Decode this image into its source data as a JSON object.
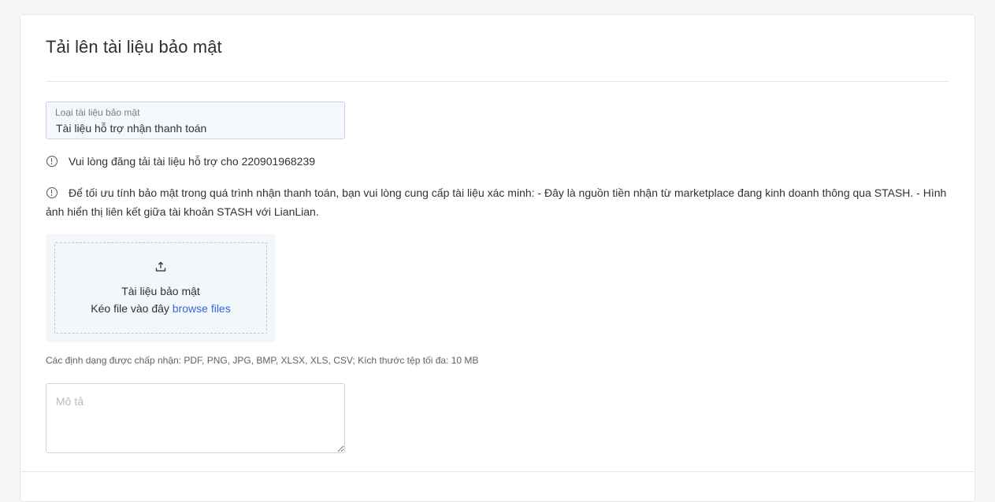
{
  "page": {
    "title": "Tải lên tài liệu bảo mật"
  },
  "document_type": {
    "label": "Loại tài liệu bảo mật",
    "value": "Tài liệu hỗ trợ nhận thanh toán"
  },
  "notices": [
    {
      "icon": "info-circle-icon",
      "text": "Vui lòng đăng tải tài liệu hỗ trợ cho 220901968239"
    },
    {
      "icon": "info-circle-icon",
      "text": "Để tối ưu tính bảo mật trong quá trình nhận thanh toán, bạn vui lòng cung cấp tài liệu xác minh: - Đây là nguồn tiền nhận từ marketplace đang kinh doanh thông qua STASH. - Hình ảnh hiển thị liên kết giữa tài khoản STASH với LianLian."
    }
  ],
  "upload": {
    "icon": "upload-icon",
    "title": "Tài liệu bảo mật",
    "hint": "Kéo file vào đây",
    "browse_label": "browse files"
  },
  "formats_note": "Các định dạng được chấp nhận: PDF, PNG, JPG, BMP, XLSX, XLS, CSV; Kích thước tệp tối đa: 10 MB",
  "description": {
    "placeholder": "Mô tả",
    "value": ""
  },
  "colors": {
    "link": "#2f6ad9",
    "upload_bg": "#f3f6fa",
    "select_bg": "#f4f7fb"
  }
}
